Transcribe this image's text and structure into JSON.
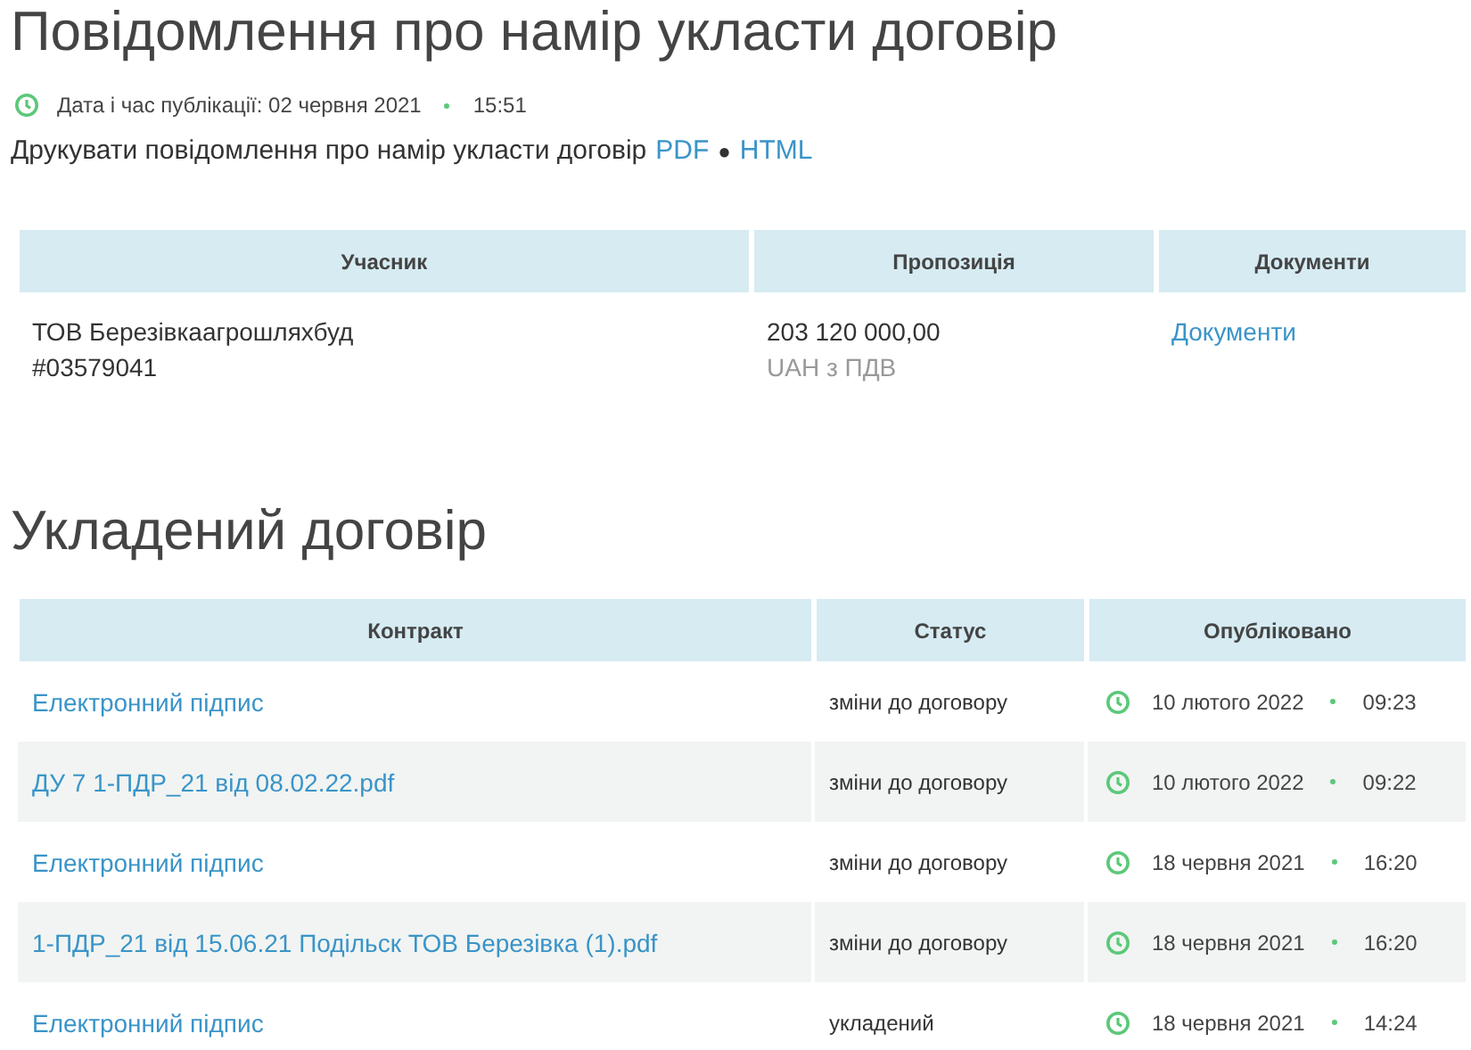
{
  "title": "Повідомлення про намір укласти договір",
  "publication": {
    "label": "Дата і час публікації: 02 червня 2021",
    "time": "15:51"
  },
  "print": {
    "text": "Друкувати повідомлення про намір укласти договір",
    "links": [
      "PDF",
      "HTML"
    ],
    "separator": "●"
  },
  "participants_table": {
    "columns": [
      "Учасник",
      "Пропозиція",
      "Документи"
    ],
    "rows": [
      {
        "name": "ТОВ Березівкаагрошляхбуд",
        "code": "#03579041",
        "amount": "203 120 000,00",
        "currency": "UAH з ПДВ",
        "documents": "Документи"
      }
    ]
  },
  "contract_title": "Укладений договір",
  "contracts_table": {
    "columns": [
      "Контракт",
      "Статус",
      "Опубліковано"
    ],
    "rows": [
      {
        "contract": "Електронний підпис",
        "status": "зміни до договору",
        "date": "10 лютого 2022",
        "time": "09:23"
      },
      {
        "contract": "ДУ 7 1-ПДР_21 від 08.02.22.pdf",
        "status": "зміни до договору",
        "date": "10 лютого 2022",
        "time": "09:22"
      },
      {
        "contract": "Електронний підпис",
        "status": "зміни до договору",
        "date": "18 червня 2021",
        "time": "16:20"
      },
      {
        "contract": "1-ПДР_21 від 15.06.21 Подільск ТОВ Березівка (1).pdf",
        "status": "зміни до договору",
        "date": "18 червня 2021",
        "time": "16:20"
      },
      {
        "contract": "Електронний підпис",
        "status": "укладений",
        "date": "18 червня 2021",
        "time": "14:24"
      }
    ]
  }
}
